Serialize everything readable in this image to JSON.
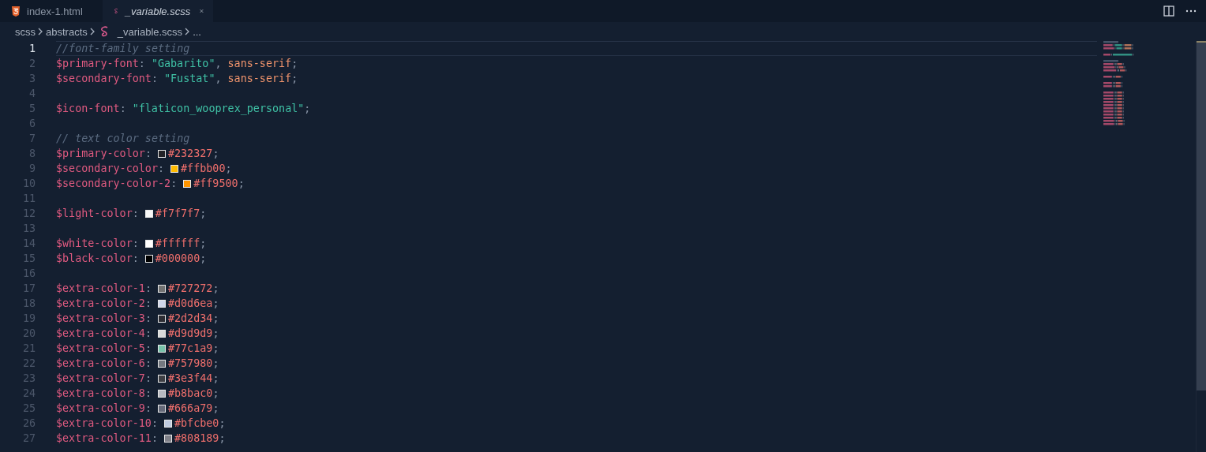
{
  "tabs": [
    {
      "label": "index-1.html",
      "kind": "html",
      "selected": false
    },
    {
      "label": "_variable.scss",
      "kind": "sass",
      "selected": true
    }
  ],
  "breadcrumb": {
    "items": [
      {
        "label": "scss",
        "kind": "folder"
      },
      {
        "label": "abstracts",
        "kind": "folder"
      },
      {
        "label": "_variable.scss",
        "kind": "sass"
      },
      {
        "label": "...",
        "kind": "more"
      }
    ]
  },
  "editor": {
    "lines": [
      {
        "number": "1",
        "current": true,
        "tokens": [
          {
            "kind": "comment",
            "text": "//font-family setting"
          }
        ]
      },
      {
        "number": "2",
        "current": false,
        "tokens": [
          {
            "kind": "var",
            "text": "$primary-font"
          },
          {
            "kind": "punct",
            "text": ":"
          },
          {
            "kind": "string",
            "text": "\"Gabarito\""
          },
          {
            "kind": "punct",
            "text": ","
          },
          {
            "kind": "keyword",
            "text": "sans-serif"
          },
          {
            "kind": "punct",
            "text": ";"
          }
        ]
      },
      {
        "number": "3",
        "current": false,
        "tokens": [
          {
            "kind": "var",
            "text": "$secondary-font"
          },
          {
            "kind": "punct",
            "text": ":"
          },
          {
            "kind": "string",
            "text": "\"Fustat\""
          },
          {
            "kind": "punct",
            "text": ","
          },
          {
            "kind": "keyword",
            "text": "sans-serif"
          },
          {
            "kind": "punct",
            "text": ";"
          }
        ]
      },
      {
        "number": "4",
        "current": false
      },
      {
        "number": "5",
        "current": false,
        "tokens": [
          {
            "kind": "var",
            "text": "$icon-font"
          },
          {
            "kind": "punct",
            "text": ":"
          },
          {
            "kind": "string",
            "text": "\"flaticon_wooprex_personal\""
          },
          {
            "kind": "punct",
            "text": ";"
          }
        ]
      },
      {
        "number": "6",
        "current": false
      },
      {
        "number": "7",
        "current": false,
        "tokens": [
          {
            "kind": "comment",
            "text": "// text color setting"
          }
        ]
      },
      {
        "number": "8",
        "current": false,
        "tokens": [
          {
            "kind": "var",
            "text": "$primary-color"
          },
          {
            "kind": "punct",
            "text": ":"
          },
          {
            "kind": "swatch",
            "color": "#232327"
          },
          {
            "kind": "hex",
            "text": "#232327"
          },
          {
            "kind": "punct",
            "text": ";"
          }
        ]
      },
      {
        "number": "9",
        "current": false,
        "tokens": [
          {
            "kind": "var",
            "text": "$secondary-color"
          },
          {
            "kind": "punct",
            "text": ":"
          },
          {
            "kind": "swatch",
            "color": "#ffbb00"
          },
          {
            "kind": "hex",
            "text": "#ffbb00"
          },
          {
            "kind": "punct",
            "text": ";"
          }
        ]
      },
      {
        "number": "10",
        "current": false,
        "tokens": [
          {
            "kind": "var",
            "text": "$secondary-color-2"
          },
          {
            "kind": "punct",
            "text": ":"
          },
          {
            "kind": "swatch",
            "color": "#ff9500"
          },
          {
            "kind": "hex",
            "text": "#ff9500"
          },
          {
            "kind": "punct",
            "text": ";"
          }
        ]
      },
      {
        "number": "11",
        "current": false
      },
      {
        "number": "12",
        "current": false,
        "tokens": [
          {
            "kind": "var",
            "text": "$light-color"
          },
          {
            "kind": "punct",
            "text": ":"
          },
          {
            "kind": "swatch",
            "color": "#f7f7f7"
          },
          {
            "kind": "hex",
            "text": "#f7f7f7"
          },
          {
            "kind": "punct",
            "text": ";"
          }
        ]
      },
      {
        "number": "13",
        "current": false
      },
      {
        "number": "14",
        "current": false,
        "tokens": [
          {
            "kind": "var",
            "text": "$white-color"
          },
          {
            "kind": "punct",
            "text": ":"
          },
          {
            "kind": "swatch",
            "color": "#ffffff"
          },
          {
            "kind": "hex",
            "text": "#ffffff"
          },
          {
            "kind": "punct",
            "text": ";"
          }
        ]
      },
      {
        "number": "15",
        "current": false,
        "tokens": [
          {
            "kind": "var",
            "text": "$black-color"
          },
          {
            "kind": "punct",
            "text": ":"
          },
          {
            "kind": "swatch",
            "color": "#000000"
          },
          {
            "kind": "hex",
            "text": "#000000"
          },
          {
            "kind": "punct",
            "text": ";"
          }
        ]
      },
      {
        "number": "16",
        "current": false
      },
      {
        "number": "17",
        "current": false,
        "tokens": [
          {
            "kind": "var",
            "text": "$extra-color-1"
          },
          {
            "kind": "punct",
            "text": ":"
          },
          {
            "kind": "swatch",
            "color": "#727272"
          },
          {
            "kind": "hex",
            "text": "#727272"
          },
          {
            "kind": "punct",
            "text": ";"
          }
        ]
      },
      {
        "number": "18",
        "current": false,
        "tokens": [
          {
            "kind": "var",
            "text": "$extra-color-2"
          },
          {
            "kind": "punct",
            "text": ":"
          },
          {
            "kind": "swatch",
            "color": "#d0d6ea"
          },
          {
            "kind": "hex",
            "text": "#d0d6ea"
          },
          {
            "kind": "punct",
            "text": ";"
          }
        ]
      },
      {
        "number": "19",
        "current": false,
        "tokens": [
          {
            "kind": "var",
            "text": "$extra-color-3"
          },
          {
            "kind": "punct",
            "text": ":"
          },
          {
            "kind": "swatch",
            "color": "#2d2d34"
          },
          {
            "kind": "hex",
            "text": "#2d2d34"
          },
          {
            "kind": "punct",
            "text": ";"
          }
        ]
      },
      {
        "number": "20",
        "current": false,
        "tokens": [
          {
            "kind": "var",
            "text": "$extra-color-4"
          },
          {
            "kind": "punct",
            "text": ":"
          },
          {
            "kind": "swatch",
            "color": "#d9d9d9"
          },
          {
            "kind": "hex",
            "text": "#d9d9d9"
          },
          {
            "kind": "punct",
            "text": ";"
          }
        ]
      },
      {
        "number": "21",
        "current": false,
        "tokens": [
          {
            "kind": "var",
            "text": "$extra-color-5"
          },
          {
            "kind": "punct",
            "text": ":"
          },
          {
            "kind": "swatch",
            "color": "#77c1a9"
          },
          {
            "kind": "hex",
            "text": "#77c1a9"
          },
          {
            "kind": "punct",
            "text": ";"
          }
        ]
      },
      {
        "number": "22",
        "current": false,
        "tokens": [
          {
            "kind": "var",
            "text": "$extra-color-6"
          },
          {
            "kind": "punct",
            "text": ":"
          },
          {
            "kind": "swatch",
            "color": "#757980"
          },
          {
            "kind": "hex",
            "text": "#757980"
          },
          {
            "kind": "punct",
            "text": ";"
          }
        ]
      },
      {
        "number": "23",
        "current": false,
        "tokens": [
          {
            "kind": "var",
            "text": "$extra-color-7"
          },
          {
            "kind": "punct",
            "text": ":"
          },
          {
            "kind": "swatch",
            "color": "#3e3f44"
          },
          {
            "kind": "hex",
            "text": "#3e3f44"
          },
          {
            "kind": "punct",
            "text": ";"
          }
        ]
      },
      {
        "number": "24",
        "current": false,
        "tokens": [
          {
            "kind": "var",
            "text": "$extra-color-8"
          },
          {
            "kind": "punct",
            "text": ":"
          },
          {
            "kind": "swatch",
            "color": "#b8bac0"
          },
          {
            "kind": "hex",
            "text": "#b8bac0"
          },
          {
            "kind": "punct",
            "text": ";"
          }
        ]
      },
      {
        "number": "25",
        "current": false,
        "tokens": [
          {
            "kind": "var",
            "text": "$extra-color-9"
          },
          {
            "kind": "punct",
            "text": ":"
          },
          {
            "kind": "swatch",
            "color": "#666a79"
          },
          {
            "kind": "hex",
            "text": "#666a79"
          },
          {
            "kind": "punct",
            "text": ";"
          }
        ]
      },
      {
        "number": "26",
        "current": false,
        "tokens": [
          {
            "kind": "var",
            "text": "$extra-color-10"
          },
          {
            "kind": "punct",
            "text": ":"
          },
          {
            "kind": "swatch",
            "color": "#bfcbe0"
          },
          {
            "kind": "hex",
            "text": "#bfcbe0"
          },
          {
            "kind": "punct",
            "text": ";"
          }
        ]
      },
      {
        "number": "27",
        "current": false,
        "tokens": [
          {
            "kind": "var",
            "text": "$extra-color-11"
          },
          {
            "kind": "punct",
            "text": ":"
          },
          {
            "kind": "swatch",
            "color": "#808189"
          },
          {
            "kind": "hex",
            "text": "#808189"
          },
          {
            "kind": "punct",
            "text": ";"
          }
        ]
      }
    ]
  }
}
